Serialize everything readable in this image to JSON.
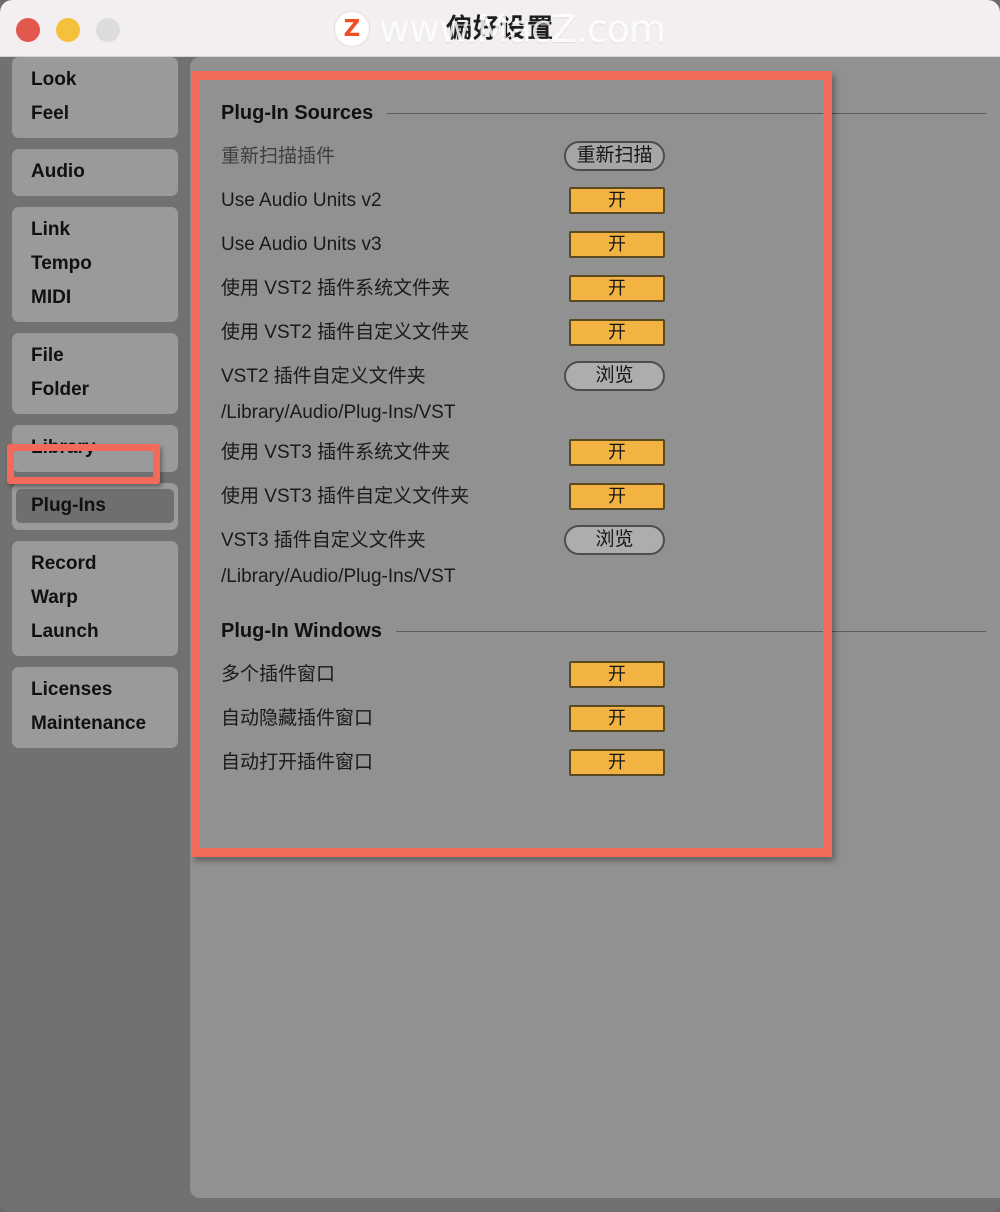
{
  "window": {
    "title": "偏好设置",
    "watermark_badge": "Z",
    "watermark_text": "www.MacZ.com",
    "traffic": {
      "close": "close-button",
      "minimize": "minimize-button",
      "zoom": "zoom-button"
    },
    "colors": {
      "accent_highlight": "#f26a5a",
      "toggle_on": "#f3b342",
      "sidebar_bg": "#717171",
      "panel_bg": "#919191",
      "sidebar_item_bg": "#9a9a9a",
      "sidebar_selected_bg": "#6f6f6f"
    }
  },
  "sidebar": {
    "groups": [
      {
        "items": [
          {
            "label": "Look",
            "selected": false
          },
          {
            "label": "Feel",
            "selected": false
          }
        ]
      },
      {
        "items": [
          {
            "label": "Audio",
            "selected": false
          }
        ]
      },
      {
        "items": [
          {
            "label": "Link",
            "selected": false
          },
          {
            "label": "Tempo",
            "selected": false
          },
          {
            "label": "MIDI",
            "selected": false
          }
        ]
      },
      {
        "items": [
          {
            "label": "File",
            "selected": false
          },
          {
            "label": "Folder",
            "selected": false
          }
        ]
      },
      {
        "items": [
          {
            "label": "Library",
            "selected": false
          }
        ]
      },
      {
        "items": [
          {
            "label": "Plug-Ins",
            "selected": true
          }
        ]
      },
      {
        "items": [
          {
            "label": "Record",
            "selected": false
          },
          {
            "label": "Warp",
            "selected": false
          },
          {
            "label": "Launch",
            "selected": false
          }
        ]
      },
      {
        "items": [
          {
            "label": "Licenses",
            "selected": false
          },
          {
            "label": "Maintenance",
            "selected": false
          }
        ]
      }
    ]
  },
  "main": {
    "sections": [
      {
        "title": "Plug-In Sources",
        "rows": [
          {
            "label": "重新扫描插件",
            "dim": true,
            "control": "pill",
            "control_label": "重新扫描"
          },
          {
            "label": "Use Audio Units v2",
            "control": "toggle",
            "control_label": "开"
          },
          {
            "label": "Use Audio Units v3",
            "control": "toggle",
            "control_label": "开"
          },
          {
            "label": "使用 VST2 插件系统文件夹",
            "control": "toggle",
            "control_label": "开"
          },
          {
            "label": "使用 VST2 插件自定义文件夹",
            "control": "toggle",
            "control_label": "开"
          },
          {
            "label": "VST2 插件自定义文件夹",
            "sub": "/Library/Audio/Plug-Ins/VST",
            "control": "pill-light",
            "control_label": "浏览"
          },
          {
            "label": "使用 VST3 插件系统文件夹",
            "control": "toggle",
            "control_label": "开"
          },
          {
            "label": "使用 VST3 插件自定义文件夹",
            "control": "toggle",
            "control_label": "开"
          },
          {
            "label": "VST3 插件自定义文件夹",
            "sub": "/Library/Audio/Plug-Ins/VST",
            "control": "pill-light",
            "control_label": "浏览"
          }
        ]
      },
      {
        "title": "Plug-In Windows",
        "rows": [
          {
            "label": "多个插件窗口",
            "control": "toggle",
            "control_label": "开"
          },
          {
            "label": "自动隐藏插件窗口",
            "control": "toggle",
            "control_label": "开"
          },
          {
            "label": "自动打开插件窗口",
            "control": "toggle",
            "control_label": "开"
          }
        ]
      }
    ]
  }
}
